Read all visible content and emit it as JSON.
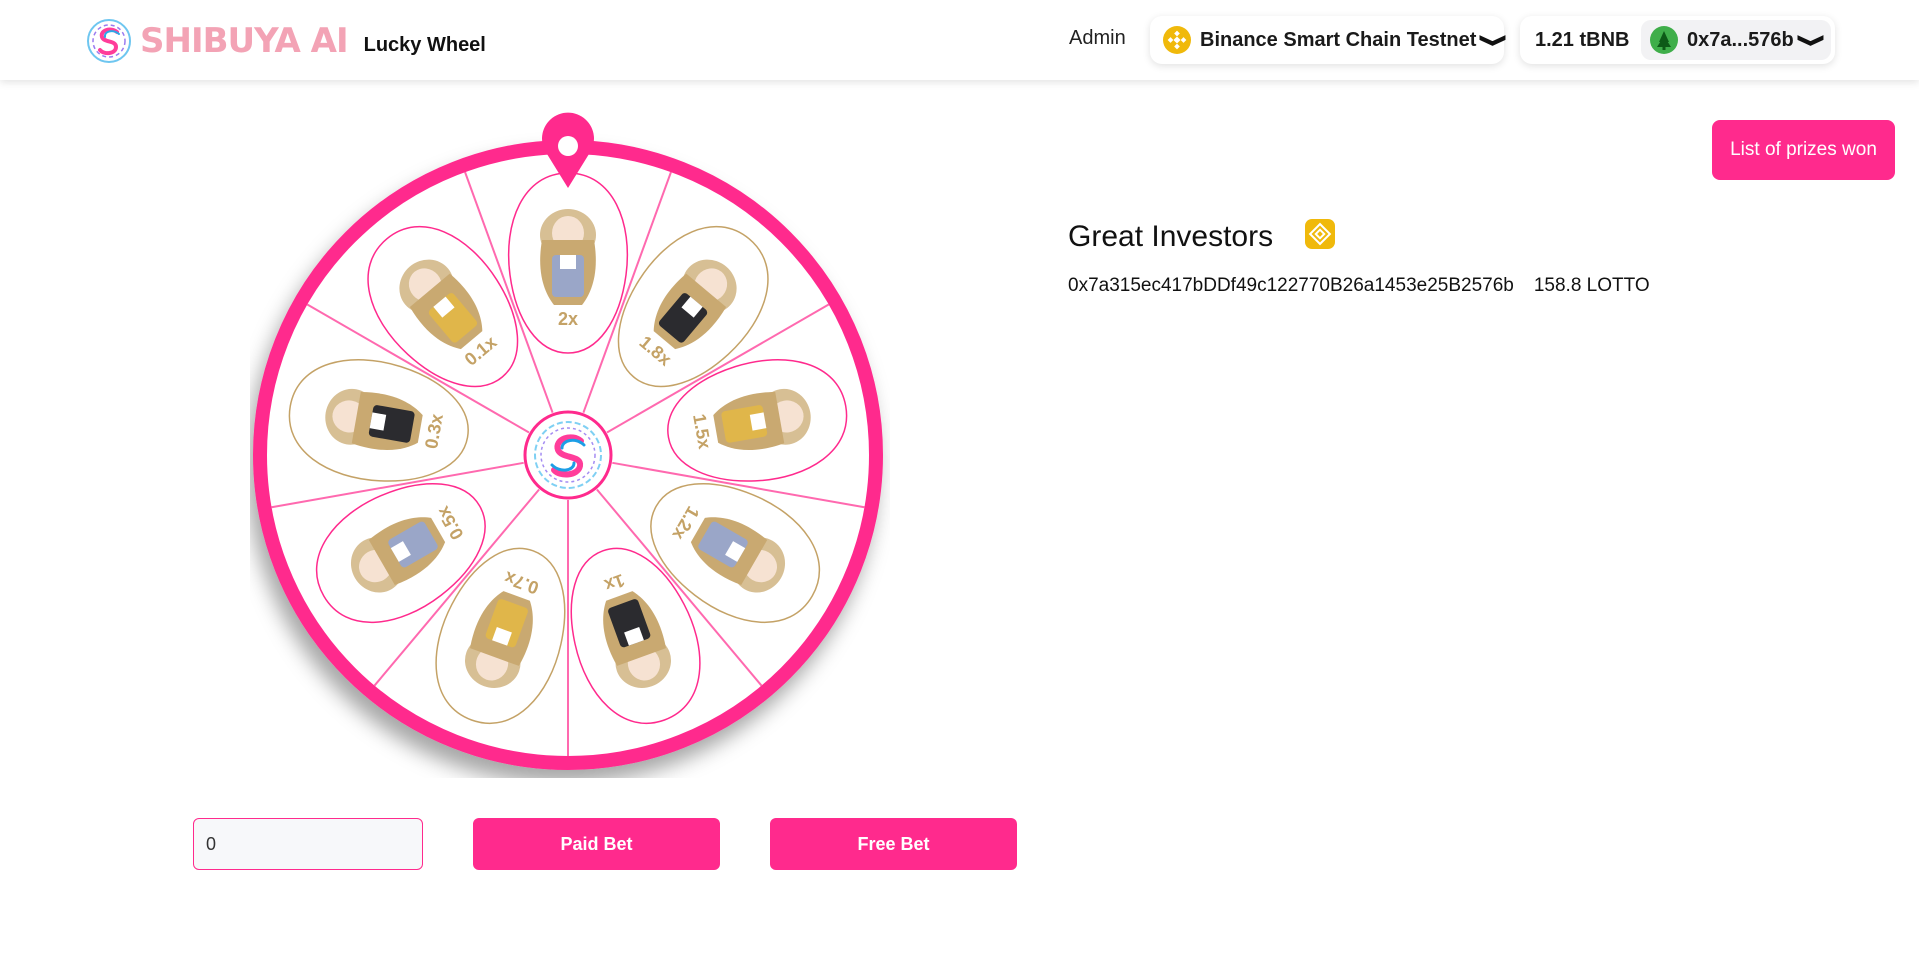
{
  "header": {
    "brand_name": "SHIBUYA AI",
    "app_title": "Lucky Wheel",
    "admin_label": "Admin",
    "network_name": "Binance Smart Chain Testnet",
    "balance": "1.21 tBNB",
    "address_short": "0x7a...576b",
    "chevron": "❯"
  },
  "wheel": {
    "segments": [
      "2x",
      "1.8x",
      "1.5x",
      "1.2x",
      "1x",
      "0.7x",
      "0.5x",
      "0.3x",
      "0.1x"
    ],
    "colors": {
      "primary": "#ff2a8d",
      "gold": "#c4a266"
    }
  },
  "controls": {
    "bet_value": "0",
    "paid_bet_label": "Paid Bet",
    "free_bet_label": "Free Bet"
  },
  "panel": {
    "prizes_button_label": "List of prizes won",
    "investors_title": "Great Investors",
    "investors": [
      {
        "address": "0x7a315ec417bDDf49c122770B26a1453e25B2576b",
        "amount": "158.8 LOTTO"
      }
    ]
  },
  "icons": {
    "brand": "shibuya-logo-icon",
    "network": "bnb-coin-icon",
    "account": "avatar-icon",
    "pointer": "map-pin-icon",
    "hub": "shibuya-logo-icon",
    "investors": "bnb-badge-icon"
  }
}
